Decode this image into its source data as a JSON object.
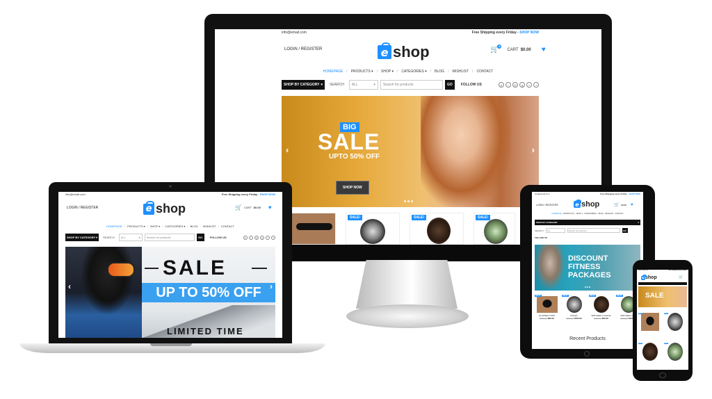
{
  "site": {
    "email": "info@email.com",
    "shipping_text": "Free Shipping every Friday -",
    "shipping_cta": "SHOP NOW",
    "login": "LOGIN / REGISTER",
    "logo_letter": "e",
    "logo_text": "shop",
    "cart_label": "CART",
    "cart_total": "$0.00",
    "cart_count": "0",
    "wishlist_count": "0"
  },
  "nav": [
    "HOMEPAGE",
    "PRODUCTS ▾",
    "SHOP ▾",
    "CATEGORIES ▾",
    "BLOG",
    "WISHLIST",
    "CONTACT"
  ],
  "catbar": {
    "category_button": "SHOP BY CATEGORY",
    "search_label": "SEARCH",
    "select_value": "ALL",
    "search_placeholder": "Search for products",
    "go": "GO",
    "follow": "FOLLOW US"
  },
  "social_icons": [
    "pinterest-icon",
    "rss-icon",
    "instagram-icon",
    "google-plus-icon",
    "twitter-icon",
    "facebook-icon"
  ],
  "desktop_hero": {
    "badge": "BIG",
    "title": "SALE",
    "subtitle": "UPTO 50% OFF",
    "cta": "SHOP NOW"
  },
  "laptop_hero": {
    "title": "SALE",
    "subtitle": "UP TO 50% OFF",
    "footer": "LIMITED TIME"
  },
  "tablet_hero": {
    "line1": "DISCOUNT",
    "line2": "FITNESS",
    "line3": "PACKAGES"
  },
  "sale_label": "SALE!",
  "tablet_products": [
    {
      "name": "GLASSES TOPS",
      "old": "$100.00",
      "price": "$80.00"
    },
    {
      "name": "ROLEX",
      "old": "$700.00",
      "price": "$500.00"
    },
    {
      "name": "WATCHES X ALPHA",
      "old": "$200.00",
      "price": "$90.00"
    },
    {
      "name": "WATCHES X X2",
      "old": "$200.00",
      "price": "$150.00"
    }
  ],
  "tablet_section": "Recent Products",
  "phone_hero": {
    "title": "SALE"
  }
}
